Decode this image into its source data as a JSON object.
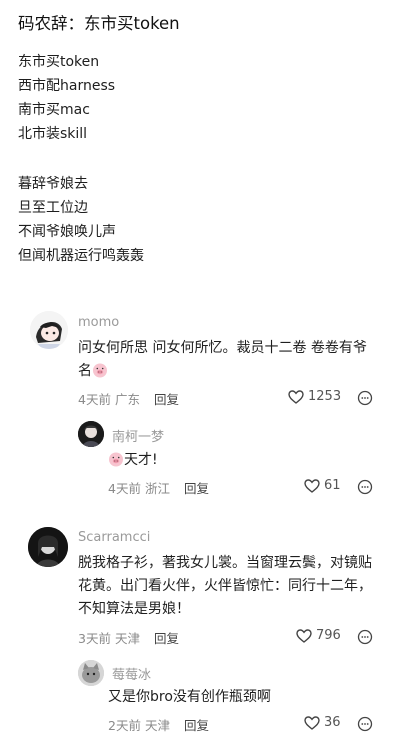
{
  "post": {
    "title": "码农辞：东市买token",
    "stanza1": [
      "东市买token",
      "西市配harness",
      "南市买mac",
      "北市装skill"
    ],
    "stanza2": [
      "暮辞爷娘去",
      "旦至工位边",
      "不闻爷娘唤儿声",
      "但闻机器运行鸣轰轰"
    ]
  },
  "comments": [
    {
      "user": "momo",
      "text": "问女何所思 问女何所忆。裁员十二卷 卷卷有爷名",
      "time": "4天前",
      "location": "广东",
      "reply": "回复",
      "likes": "1253",
      "replies": [
        {
          "user": "南柯一梦",
          "text": "天才!",
          "time": "4天前",
          "location": "浙江",
          "reply": "回复",
          "likes": "61"
        }
      ]
    },
    {
      "user": "Scarramcci",
      "text": "脱我格子衫，著我女儿裳。当窗理云鬓，对镜贴花黄。出门看火伴，火伴皆惊忙：同行十二年，不知算法是男娘！",
      "time": "3天前",
      "location": "天津",
      "reply": "回复",
      "likes": "796",
      "replies": [
        {
          "user": "莓莓冰",
          "text": "又是你bro没有创作瓶颈啊",
          "time": "2天前",
          "location": "天津",
          "reply": "回复",
          "likes": "36"
        }
      ]
    }
  ]
}
